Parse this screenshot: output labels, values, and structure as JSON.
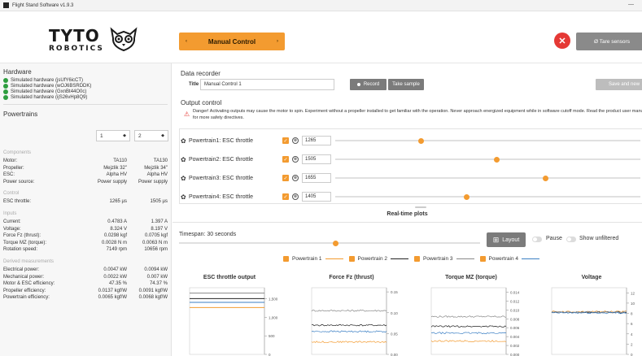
{
  "window": {
    "title": "Flight Stand Software v1.9.3",
    "minimize": "—"
  },
  "header": {
    "logo_line1": "TYTO",
    "logo_line2": "ROBOTICS",
    "mode_label": "Manual Control",
    "mode_prev": "‹",
    "mode_next": "›",
    "stop_glyph": "✕",
    "tare_label": "Ø Tare sensors"
  },
  "hardware": {
    "title": "Hardware",
    "items": [
      "Simulated hardware (jsUfY6icCT)",
      "Simulated hardware (wOJ6BSRDDK)",
      "Simulated hardware (GxnBt44O0c)",
      "Simulated hardware (ijS26vHp8Q9)"
    ]
  },
  "powertrains": {
    "title": "Powertrains",
    "select1": "1",
    "select2": "2",
    "components_label": "Components",
    "components": [
      {
        "label": "Motor:",
        "v1": "TA110",
        "v2": "TA130"
      },
      {
        "label": "Propeller:",
        "v1": "Mejzlik 32\"",
        "v2": "Mejzlik 34\""
      },
      {
        "label": "ESC:",
        "v1": "Alpha HV",
        "v2": "Alpha HV"
      },
      {
        "label": "Power source:",
        "v1": "Power supply",
        "v2": "Power supply"
      }
    ],
    "control_label": "Control",
    "control": [
      {
        "label": "ESC throttle:",
        "v1": "1265 µs",
        "v2": "1505 µs"
      }
    ],
    "inputs_label": "Inputs",
    "inputs": [
      {
        "label": "Current:",
        "v1": "0.4783 A",
        "v2": "1.397 A"
      },
      {
        "label": "Voltage:",
        "v1": "8.324 V",
        "v2": "8.197 V"
      },
      {
        "label": "Force Fz (thrust):",
        "v1": "0.0298 kgf",
        "v2": "0.0705 kgf"
      },
      {
        "label": "Torque MZ (torque):",
        "v1": "0.0028 N m",
        "v2": "0.0063 N m"
      },
      {
        "label": "Rotation speed:",
        "v1": "7149 rpm",
        "v2": "10656 rpm"
      }
    ],
    "derived_label": "Derived measurements",
    "derived": [
      {
        "label": "Electrical power:",
        "v1": "0.0047 kW",
        "v2": "0.0094 kW"
      },
      {
        "label": "Mechanical power:",
        "v1": "0.0022 kW",
        "v2": "0.007 kW"
      },
      {
        "label": "Motor & ESC efficiency:",
        "v1": "47.35 %",
        "v2": "74.37 %"
      },
      {
        "label": "Propeller efficiency:",
        "v1": "0.0137 kgf/W",
        "v2": "0.0091 kgf/W"
      },
      {
        "label": "Powertrain efficiency:",
        "v1": "0.0065 kgf/W",
        "v2": "0.0068 kgf/W"
      }
    ]
  },
  "recorder": {
    "title": "Data recorder",
    "title_label": "Title",
    "title_value": "Manual Control 1",
    "record_label": "Record",
    "sample_label": "Take sample",
    "save_label": "Save and new"
  },
  "output": {
    "title": "Output control",
    "warning": "Danger! Activating outputs may cause the motor to spin. Experiment without a propeller installed to get familiar with the operation. Never approach energized equipment while in software cutoff mode. Read the product user manual for more safety directives.",
    "rows": [
      {
        "label": "Powertrain1: ESC throttle",
        "value": "1265",
        "fraction": 0.28
      },
      {
        "label": "Powertrain2: ESC throttle",
        "value": "1505",
        "fraction": 0.53
      },
      {
        "label": "Powertrain3: ESC throttle",
        "value": "1655",
        "fraction": 0.69
      },
      {
        "label": "Powertrain4: ESC throttle",
        "value": "1405",
        "fraction": 0.43
      }
    ]
  },
  "plots": {
    "title": "Real-time plots",
    "timespan_label": "Timespan: 30 seconds",
    "timespan_fraction": 0.52,
    "layout_label": "Layout",
    "pause_label": "Pause",
    "unfiltered_label": "Show unfiltered",
    "help_glyph": "?",
    "legend": [
      {
        "name": "Powertrain 1",
        "color": "#f39b30"
      },
      {
        "name": "Powertrain 2",
        "color": "#222222"
      },
      {
        "name": "Powertrain 3",
        "color": "#888888"
      },
      {
        "name": "Powertrain 4",
        "color": "#3b7fc4"
      }
    ]
  },
  "chart_data": [
    {
      "type": "line",
      "title": "ESC throttle output",
      "yticks": [
        "1,500",
        "1,000",
        "500",
        "0"
      ],
      "ylim": [
        0,
        1800
      ],
      "series": [
        {
          "name": "Powertrain 1",
          "color": "#f39b30",
          "level": 1265
        },
        {
          "name": "Powertrain 2",
          "color": "#222222",
          "level": 1505
        },
        {
          "name": "Powertrain 3",
          "color": "#888888",
          "level": 1655
        },
        {
          "name": "Powertrain 4",
          "color": "#3b7fc4",
          "level": 1405
        }
      ]
    },
    {
      "type": "line",
      "title": "Force Fz (thrust)",
      "yticks": [
        "0.15",
        "0.10",
        "0.05",
        "0.00"
      ],
      "ylim": [
        0,
        0.16
      ],
      "series": [
        {
          "name": "Powertrain 1",
          "color": "#f39b30",
          "level": 0.03
        },
        {
          "name": "Powertrain 2",
          "color": "#222222",
          "level": 0.07
        },
        {
          "name": "Powertrain 3",
          "color": "#888888",
          "level": 0.105
        },
        {
          "name": "Powertrain 4",
          "color": "#3b7fc4",
          "level": 0.055
        }
      ]
    },
    {
      "type": "line",
      "title": "Torque MZ (torque)",
      "yticks": [
        "0.014",
        "0.012",
        "0.010",
        "0.008",
        "0.006",
        "0.004",
        "0.002",
        "0.000"
      ],
      "ylim": [
        0,
        0.015
      ],
      "series": [
        {
          "name": "Powertrain 1",
          "color": "#f39b30",
          "level": 0.003
        },
        {
          "name": "Powertrain 2",
          "color": "#222222",
          "level": 0.0063
        },
        {
          "name": "Powertrain 3",
          "color": "#888888",
          "level": 0.0085
        },
        {
          "name": "Powertrain 4",
          "color": "#3b7fc4",
          "level": 0.0048
        }
      ]
    },
    {
      "type": "line",
      "title": "Voltage",
      "yticks": [
        "12",
        "10",
        "8",
        "6",
        "4",
        "2",
        "0"
      ],
      "ylim": [
        0,
        13
      ],
      "series": [
        {
          "name": "Powertrain 1",
          "color": "#f39b30",
          "level": 8.32
        },
        {
          "name": "Powertrain 2",
          "color": "#222222",
          "level": 8.2
        },
        {
          "name": "Powertrain 3",
          "color": "#888888",
          "level": 8.25
        },
        {
          "name": "Powertrain 4",
          "color": "#3b7fc4",
          "level": 8.1
        }
      ]
    }
  ]
}
